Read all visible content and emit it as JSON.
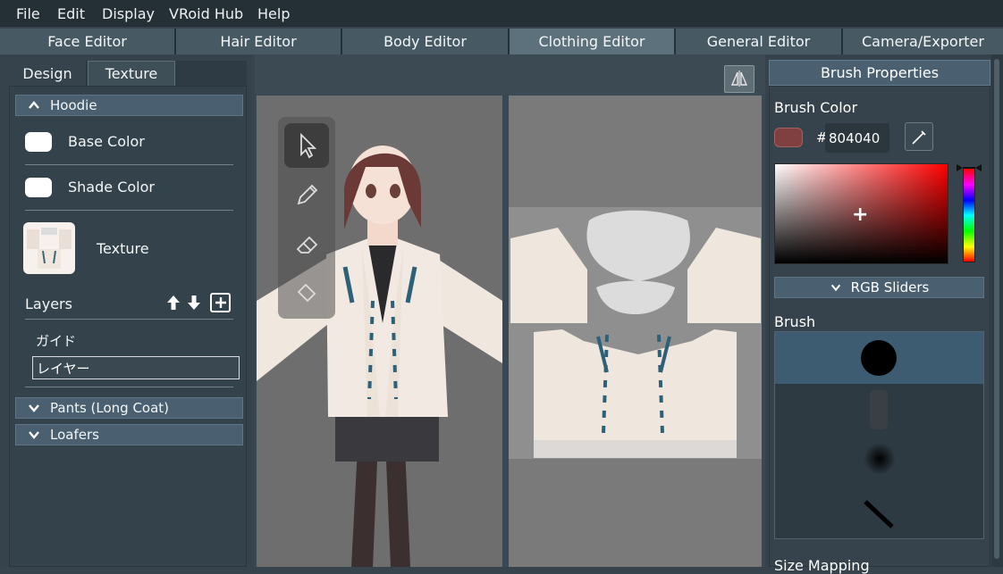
{
  "menu": [
    "File",
    "Edit",
    "Display",
    "VRoid Hub",
    "Help"
  ],
  "editor_tabs": [
    "Face Editor",
    "Hair Editor",
    "Body Editor",
    "Clothing Editor",
    "General Editor",
    "Camera/Exporter"
  ],
  "left": {
    "tabs": [
      "Design",
      "Texture"
    ],
    "section": "Hoodie",
    "base_color": "Base Color",
    "shade_color": "Shade Color",
    "texture": "Texture",
    "layers": "Layers",
    "layer_items": [
      "ガイド"
    ],
    "layer_input_value": "レイヤー",
    "other_sections": [
      "Pants (Long Coat)",
      "Loafers"
    ]
  },
  "right": {
    "title": "Brush Properties",
    "brush_color_label": "Brush Color",
    "hash": "#",
    "hex": "804040",
    "rgb_sliders": "RGB Sliders",
    "brush_label": "Brush",
    "size_mapping": "Size Mapping"
  },
  "colors": {
    "brush_color": "#804040",
    "accent": "#4a6070"
  }
}
